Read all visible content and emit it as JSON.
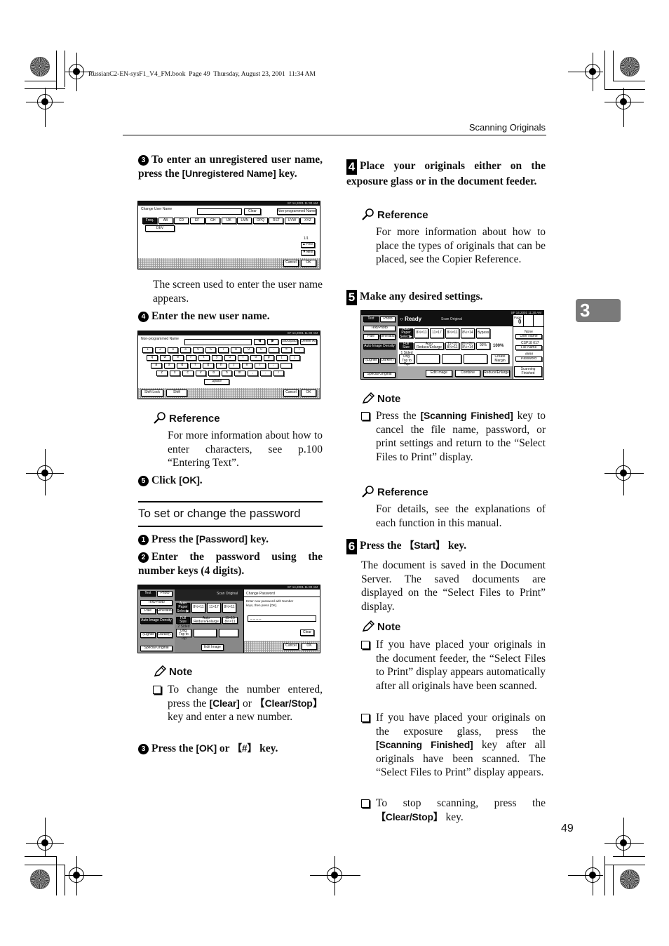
{
  "book_meta": "RussianC2-EN-sysF1_V4_FM.book  Page 49  Thursday, August 23, 2001  11:34 AM",
  "header": {
    "title": "Scanning Originals"
  },
  "chapter_tab": "3",
  "page_number": "49",
  "left": {
    "step3": {
      "num": "3",
      "pre": "To enter an unregistered user name, press the ",
      "key": "[Unregistered Name]",
      "post": " key."
    },
    "screen1": {
      "status": "SF 14,2001 11:30 AM",
      "title": "Change User Name",
      "clear": "Clear",
      "non_programmed": "Non-programmed Name",
      "tabs": [
        "Freq.",
        "AB",
        "CD",
        "EF",
        "GH",
        "IJK",
        "LMN",
        "OPQ",
        "RST",
        "UVW",
        "XYZ"
      ],
      "entry": "DEV",
      "page": "1/1",
      "prev": "▲Prev.",
      "next": "▼Next",
      "cancel": "Cancel",
      "ok": "OK"
    },
    "screen1_caption": "The screen used to enter the user name appears.",
    "step4": {
      "num": "4",
      "text": "Enter the new user name."
    },
    "screen2": {
      "status": "SF 14,2001 11:30 AM",
      "title": "Non-programmed Name",
      "left_arrow": "◀",
      "right_arrow": "▶",
      "backspace": "Backspace",
      "delete_all": "Delete All",
      "row1": [
        "1",
        "2",
        "3",
        "4",
        "5",
        "6",
        "7",
        "8",
        "9",
        "0",
        "-",
        "=",
        "\\"
      ],
      "row2": [
        "q",
        "w",
        "e",
        "r",
        "t",
        "y",
        "u",
        "i",
        "o",
        "p",
        "[",
        "]"
      ],
      "row3": [
        "a",
        "s",
        "d",
        "f",
        "g",
        "h",
        "j",
        "k",
        "l",
        ";",
        "'"
      ],
      "row4": [
        "z",
        "x",
        "c",
        "v",
        "b",
        "n",
        "m",
        ",",
        ".",
        "/"
      ],
      "space": "Space",
      "shift_lock": "Shift Lock",
      "shift": "Shift",
      "cancel": "Cancel",
      "ok": "OK"
    },
    "ref1": {
      "heading": "Reference",
      "text": "For more information about how to enter characters, see p.100 “Entering Text”."
    },
    "step5": {
      "num": "5",
      "pre": "Click ",
      "key": "[OK]",
      "post": "."
    },
    "section_title": "To set or change the password",
    "pw_step1": {
      "num": "1",
      "pre": "Press the ",
      "key": "[Password]",
      "post": " key."
    },
    "pw_step2": {
      "num": "2",
      "text": "Enter the password using the number keys (4 digits)."
    },
    "screen3": {
      "status": "SF 14,2001 11:30 AM",
      "text_btn": "Text",
      "photo_btn": "Photo",
      "text_photo": "Text/Photo",
      "pale": "Pale",
      "generation": "Generation",
      "auto_density": "Auto Image Density",
      "lighter": "◁Lighter",
      "darker": "Darker▷",
      "special_original": "Special Original",
      "scan_original": "Scan Original",
      "auto_paper": "Auto Paper Select▶",
      "paper1": "8½×11",
      "paper2": "11×17",
      "paper3": "8½×11",
      "full_size": "Full Size",
      "auto_reduce": "Auto Reduce/Enlarge",
      "ratio": "11×15 8½×11",
      "two_sided": "2 Sided Orig. Top to Top",
      "edit_image": "Edit Image",
      "dialog_title": "Change Password",
      "dialog_msg": "Enter new password with Number keys, then press [OK].",
      "dialog_field": "_ _ _ _",
      "clear": "Clear",
      "cancel": "Cancel",
      "ok": "OK"
    },
    "note1": {
      "heading": "Note",
      "items": [
        {
          "pre": "To change the number entered, press the ",
          "key1": "[Clear]",
          "mid": " or ",
          "key2": "【Clear/Stop】",
          "post": " key and enter a new number."
        }
      ]
    },
    "pw_step3": {
      "num": "3",
      "pre": "Press the ",
      "key1": "[OK]",
      "mid": " or ",
      "key2": "【#】",
      "post": " key."
    }
  },
  "right": {
    "step4": {
      "num": "4",
      "text": "Place your originals either on the exposure glass or in the document feeder."
    },
    "ref1": {
      "heading": "Reference",
      "text": "For more information about how to place the types of originals that can be placed, see the Copier Reference."
    },
    "step5": {
      "num": "5",
      "text": "Make any desired settings."
    },
    "screen4": {
      "status": "SF 14,2001 11:30 AM",
      "text_btn": "Text",
      "photo_btn": "Photo",
      "text_photo": "Text/Photo",
      "pale": "Pale",
      "generation": "Generation",
      "auto_density": "Auto Image Density",
      "lighter": "◁Lighter",
      "darker": "Darker▷",
      "special_original": "Special Original",
      "ready": "Ready",
      "scan_original": "Scan Original",
      "auto_paper": "Auto Paper Select▶",
      "papers": [
        "8½×11",
        "11×17",
        "8½×11",
        "8½×14"
      ],
      "bypass": "Bypass",
      "full_size": "Full Size",
      "auto_reduce": "Auto Reduce/Enlarge",
      "ratio1": "11×15 8½×11",
      "ratio2": "8½×8½ 8½×14",
      "pct1": "93%",
      "pct2": "100%",
      "two_sided": "1 Sided Orig. Top to Top",
      "create_margin": "Create Margin",
      "edit_image": "Edit Image",
      "combine": "Combine",
      "reduce_enlarge": "Reduce/Enlarge",
      "page_label": "Page",
      "page_value": "0",
      "none": "None",
      "user_name": "User Name",
      "file_id": "CSP18 017",
      "file_name": "File Name",
      "pw_mask": "####",
      "password": "Password",
      "scanning_finished": "Scanning Finished"
    },
    "note1": {
      "heading": "Note",
      "items": [
        {
          "pre": "Press the ",
          "key": "[Scanning Finished]",
          "post": " key to cancel the file name, password, or print settings and return to the “Select Files to Print” display."
        }
      ]
    },
    "ref2": {
      "heading": "Reference",
      "text": "For details, see the explanations of each function in this manual."
    },
    "step6": {
      "num": "6",
      "pre": "Press the ",
      "key": "【Start】",
      "post": " key."
    },
    "step6_text": "The document is saved in the Document Server. The saved documents are displayed on the “Select Files to Print” display.",
    "note2": {
      "heading": "Note",
      "items": [
        {
          "text": "If you have placed your originals in the document feeder, the “Select Files to Print” display appears automatically after all originals have been scanned."
        },
        {
          "pre": "If you have placed your originals on the exposure glass, press the ",
          "key": "[Scanning Finished]",
          "post": " key after all originals have been scanned. The “Select Files to Print” display appears."
        },
        {
          "pre": "To stop scanning, press the ",
          "key": "【Clear/Stop】",
          "post": " key."
        }
      ]
    }
  }
}
